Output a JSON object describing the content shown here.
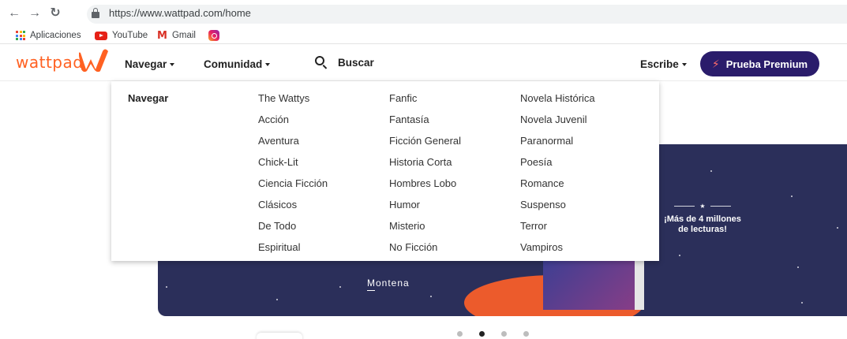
{
  "browser": {
    "url": "https://www.wattpad.com/home",
    "bookmarks": [
      {
        "label": "Aplicaciones",
        "icon": "apps-icon"
      },
      {
        "label": "YouTube",
        "icon": "youtube-icon"
      },
      {
        "label": "Gmail",
        "icon": "gmail-icon"
      },
      {
        "label": "",
        "icon": "instagram-icon"
      }
    ]
  },
  "header": {
    "logo": "wattpad",
    "nav": {
      "browse": "Navegar",
      "community": "Comunidad",
      "search": "Buscar",
      "write": "Escribe"
    },
    "premium": "Prueba Premium"
  },
  "dropdown": {
    "title": "Navegar",
    "columns": [
      [
        "The Wattys",
        "Acción",
        "Aventura",
        "Chick-Lit",
        "Ciencia Ficción",
        "Clásicos",
        "De Todo",
        "Espiritual"
      ],
      [
        "Fanfic",
        "Fantasía",
        "Ficción General",
        "Historia Corta",
        "Hombres Lobo",
        "Humor",
        "Misterio",
        "No Ficción"
      ],
      [
        "Novela Histórica",
        "Novela Juvenil",
        "Paranormal",
        "Poesía",
        "Romance",
        "Suspenso",
        "Terror",
        "Vampiros"
      ]
    ]
  },
  "banner": {
    "promo_line1": "¡Más de 4 millones",
    "promo_line2": "de lecturas!",
    "publisher": "Montena"
  },
  "carousel": {
    "total": 4,
    "active": 2
  },
  "colors": {
    "brand": "#ff6122",
    "premium_bg": "#2a1c6b",
    "banner_bg": "#2b2f5a",
    "stage": "#ec5b2c"
  }
}
